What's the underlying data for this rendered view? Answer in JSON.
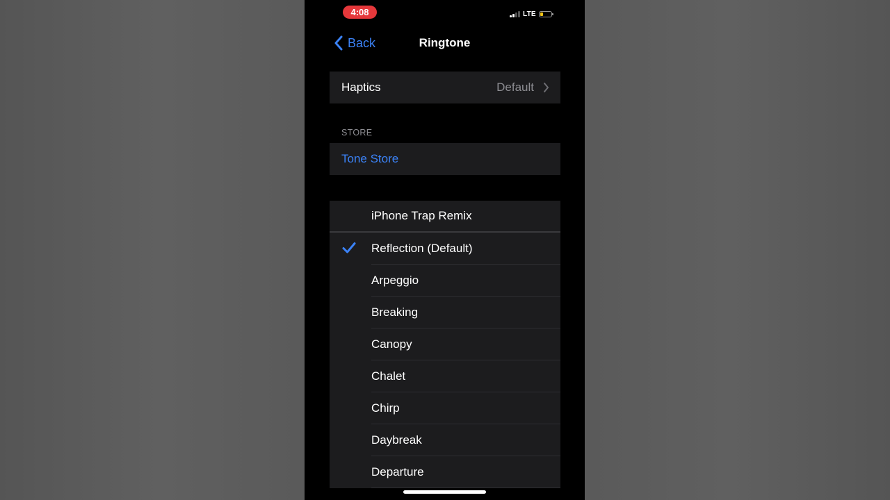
{
  "status": {
    "time": "4:08",
    "network": "LTE",
    "time_pill_color": "#e5383b"
  },
  "nav": {
    "back_label": "Back",
    "title": "Ringtone"
  },
  "haptics": {
    "label": "Haptics",
    "value": "Default"
  },
  "store": {
    "header": "STORE",
    "tone_store_label": "Tone Store"
  },
  "tones": {
    "custom": "iPhone Trap Remix",
    "selected_index": 0,
    "items": [
      "Reflection (Default)",
      "Arpeggio",
      "Breaking",
      "Canopy",
      "Chalet",
      "Chirp",
      "Daybreak",
      "Departure"
    ]
  },
  "colors": {
    "accent": "#3b82f6",
    "group_background": "#1c1c1e",
    "secondary_text": "#8e8e93"
  }
}
